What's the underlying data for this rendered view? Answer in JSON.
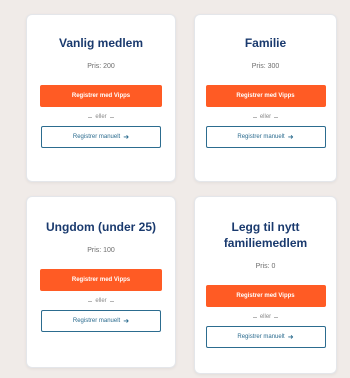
{
  "colors": {
    "title": "#1a3a6e",
    "vipps_button": "#ff5b24",
    "manual_button_border": "#2c6c8f",
    "background": "#f0ebe8"
  },
  "cards": [
    {
      "title": "Vanlig medlem",
      "price": "Pris: 200",
      "vipps_label": "Registrer med Vipps",
      "or_label": "eller",
      "manual_label": "Registrer manuelt",
      "manual_icon": "arrow-right-icon"
    },
    {
      "title": "Familie",
      "price": "Pris: 300",
      "vipps_label": "Registrer med Vipps",
      "or_label": "eller",
      "manual_label": "Registrer manuelt",
      "manual_icon": "arrow-right-icon"
    },
    {
      "title": "Ungdom (under 25)",
      "price": "Pris: 100",
      "vipps_label": "Registrer med Vipps",
      "or_label": "eller",
      "manual_label": "Registrer manuelt",
      "manual_icon": "arrow-right-icon"
    },
    {
      "title": "Legg til nytt familiemedlem",
      "price": "Pris: 0",
      "vipps_label": "Registrer med Vipps",
      "or_label": "eller",
      "manual_label": "Registrer manuelt",
      "manual_icon": "arrow-right-icon"
    }
  ]
}
